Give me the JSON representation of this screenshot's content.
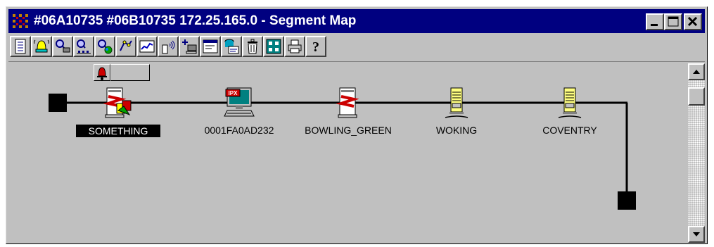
{
  "window": {
    "title": "#06A10735 #06B10735 172.25.165.0 - Segment Map",
    "controls": [
      "minimize",
      "maximize",
      "close"
    ]
  },
  "toolbar": {
    "tools": [
      "report-icon",
      "alarm-bell-icon",
      "node-scan-icon",
      "segment-scan-icon",
      "network-scan-icon",
      "map-tools-icon",
      "chart-icon",
      "wireless-icon",
      "add-node-icon",
      "properties-icon",
      "database-icon",
      "delete-icon",
      "grid-icon",
      "print-icon",
      "help-icon"
    ]
  },
  "alarm": {
    "icon": "alarm-bell-icon",
    "value": ""
  },
  "segment": {
    "nodes": [
      {
        "label": "SOMETHING",
        "icon": "server-alert-icon",
        "selected": true
      },
      {
        "label": "0001FA0AD232",
        "icon": "ipx-workstation-icon",
        "selected": false
      },
      {
        "label": "BOWLING_GREEN",
        "icon": "server-icon",
        "selected": false
      },
      {
        "label": "WOKING",
        "icon": "compaq-server-icon",
        "selected": false
      },
      {
        "label": "COVENTRY",
        "icon": "compaq-server-icon",
        "selected": false
      }
    ]
  },
  "colors": {
    "titlebar": "#000080",
    "face": "#c0c0c0",
    "selection": "#000000",
    "server_red": "#cc0000",
    "compaq_yellow": "#ffff80"
  }
}
